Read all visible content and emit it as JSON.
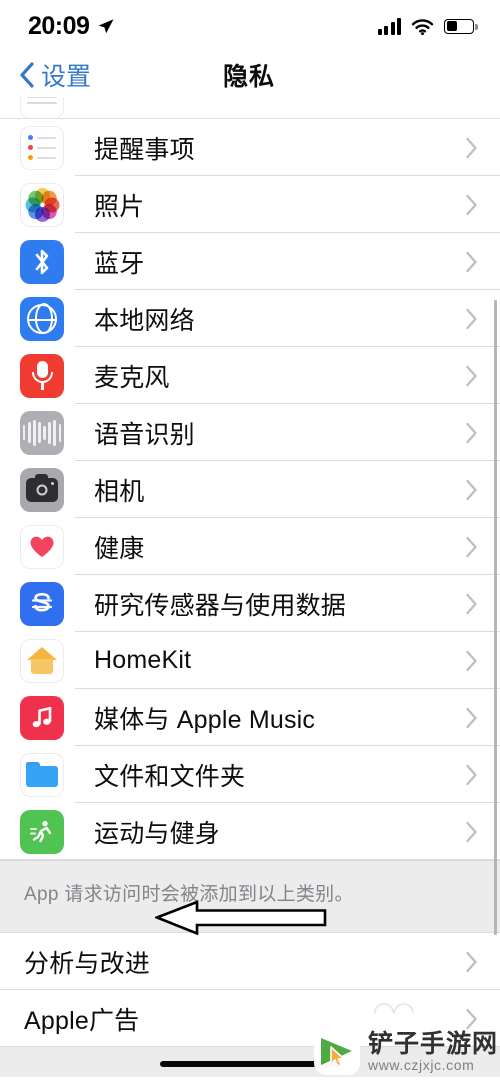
{
  "status_bar": {
    "time": "20:09",
    "location_icon": "location-arrow-icon",
    "signal_icon": "cellular-signal-icon",
    "wifi_icon": "wifi-icon",
    "battery_icon": "battery-icon",
    "battery_level_pct": 42
  },
  "nav": {
    "back_label": "设置",
    "back_icon": "chevron-left-icon",
    "title": "隐私",
    "accent_color": "#3478c6"
  },
  "list": {
    "items": [
      {
        "label": "提醒事项",
        "icon": "reminders-icon",
        "chevron": "chevron-right-icon"
      },
      {
        "label": "照片",
        "icon": "photos-icon",
        "chevron": "chevron-right-icon"
      },
      {
        "label": "蓝牙",
        "icon": "bluetooth-icon",
        "chevron": "chevron-right-icon"
      },
      {
        "label": "本地网络",
        "icon": "local-network-icon",
        "chevron": "chevron-right-icon"
      },
      {
        "label": "麦克风",
        "icon": "microphone-icon",
        "chevron": "chevron-right-icon"
      },
      {
        "label": "语音识别",
        "icon": "speech-recognition-icon",
        "chevron": "chevron-right-icon"
      },
      {
        "label": "相机",
        "icon": "camera-icon",
        "chevron": "chevron-right-icon"
      },
      {
        "label": "健康",
        "icon": "health-icon",
        "chevron": "chevron-right-icon"
      },
      {
        "label": "研究传感器与使用数据",
        "icon": "research-sensor-icon",
        "chevron": "chevron-right-icon"
      },
      {
        "label": "HomeKit",
        "icon": "homekit-icon",
        "chevron": "chevron-right-icon"
      },
      {
        "label": "媒体与 Apple Music",
        "icon": "apple-music-icon",
        "chevron": "chevron-right-icon"
      },
      {
        "label": "文件和文件夹",
        "icon": "files-icon",
        "chevron": "chevron-right-icon"
      },
      {
        "label": "运动与健身",
        "icon": "fitness-icon",
        "chevron": "chevron-right-icon"
      }
    ],
    "footer_note": "App 请求访问时会被添加到以上类别。",
    "bottom_items": [
      {
        "label": "分析与改进",
        "chevron": "chevron-right-icon"
      },
      {
        "label": "Apple广告",
        "chevron": "chevron-right-icon"
      }
    ]
  },
  "annotation": {
    "shape": "left-arrow-annotation",
    "points_to": "分析与改进"
  },
  "watermark": {
    "title": "铲子手游网",
    "url": "www.czjxjc.com",
    "logo": "cursor-play-logo",
    "logo_color": "#49a83c"
  },
  "colors": {
    "bluetooth": "#2f7bf0",
    "local_network": "#2f7bf0",
    "microphone": "#ef3b30",
    "speech": "#aeaeb4",
    "camera": "#a8a8ae",
    "research": "#2f6ff0",
    "apple_music": "#f0314b",
    "fitness": "#51c353",
    "health_heart": "#f0445f",
    "homekit": "#f4b63f",
    "files_folder": "#35a4f5",
    "separator": "#dcdce0",
    "group_bg": "#ececed"
  }
}
